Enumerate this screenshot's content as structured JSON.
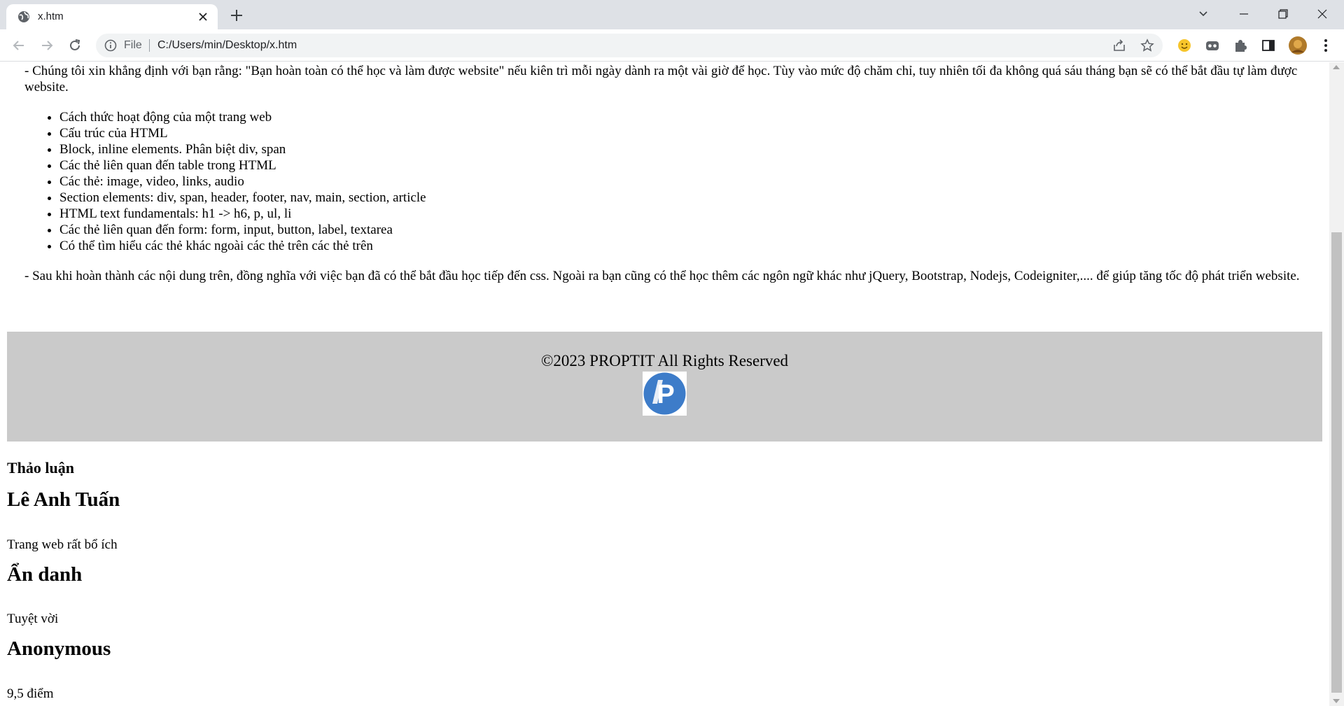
{
  "browser": {
    "tab_title": "x.htm",
    "url_scheme": "File",
    "url": "C:/Users/min/Desktop/x.htm"
  },
  "page": {
    "para1": "- Chúng tôi xin khẳng định với bạn rằng: \"Bạn hoàn toàn có thể học và làm được website\" nếu kiên trì mỗi ngày dành ra một vài giờ để học. Tùy vào mức độ chăm chỉ, tuy nhiên tối đa không quá sáu tháng bạn sẽ có thể bắt đầu tự làm được website.",
    "bullets": [
      "Cách thức hoạt động của một trang web",
      "Cấu trúc của HTML",
      "Block, inline elements. Phân biệt div, span",
      "Các thẻ liên quan đến table trong HTML",
      "Các thẻ: image, video, links, audio",
      "Section elements: div, span, header, footer, nav, main, section, article",
      "HTML text fundamentals: h1 -> h6, p, ul, li",
      "Các thẻ liên quan đến form: form, input, button, label, textarea",
      "Có thể tìm hiểu các thẻ khác ngoài các thẻ trên các thẻ trên"
    ],
    "para2": "- Sau khi hoàn thành các nội dung trên, đồng nghĩa với việc bạn đã có thể bắt đầu học tiếp đến css. Ngoài ra bạn cũng có thể học thêm các ngôn ngữ khác như jQuery, Bootstrap, Nodejs, Codeigniter,.... để giúp tăng tốc độ phát triển website.",
    "footer": {
      "copyright": "©2023 PROPTIT All Rights Reserved",
      "logo_letter": "P"
    },
    "discussion": {
      "title": "Thảo luận",
      "comments": [
        {
          "name": "Lê Anh Tuấn",
          "text": "Trang web rất bổ ích"
        },
        {
          "name": "Ẩn danh",
          "text": "Tuyệt vời"
        },
        {
          "name": "Anonymous",
          "text": "9,5 điểm"
        }
      ]
    }
  },
  "colors": {
    "footer_bg": "#cacaca",
    "logo_blue": "#3d7cc9",
    "chrome_bg": "#dee1e6"
  }
}
